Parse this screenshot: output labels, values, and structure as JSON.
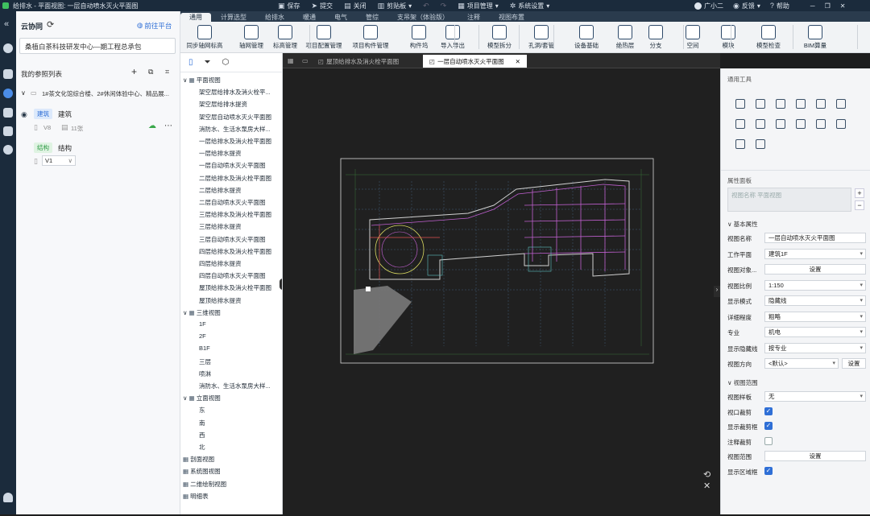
{
  "app": {
    "title": "给排水 - 平面视图: 一层自动喷水灭火平面图"
  },
  "topbar": {
    "save": "保存",
    "submit": "提交",
    "close": "关闭",
    "clipboard": "剪贴板",
    "project_mgmt": "项目管理",
    "settings": "系统设置",
    "user": "广小二",
    "feedback": "反馈",
    "help": "帮助"
  },
  "ribbon_tabs": [
    "通用",
    "计算选型",
    "给排水",
    "暖通",
    "电气",
    "管综",
    "支吊架（体验版）",
    "注释",
    "视图布置"
  ],
  "ribbon_active": "通用",
  "ribbon_buttons": [
    "同步轴网标高",
    "轴网管理",
    "标高管理",
    "项目配置管理",
    "项目构件管理",
    "构件坞",
    "导入导出",
    "模型拆分",
    "孔洞/套管",
    "设备基础",
    "绝热层",
    "分支",
    "空间",
    "模块",
    "模型检查",
    "BIM算量"
  ],
  "cloud": {
    "title": "云协同",
    "goto_platform": "前往平台",
    "project": "桑植白茶科技研发中心—期工程总承包",
    "my_refs": "我的参照列表",
    "ref_item": "1#茶文化馆综合楼、2#休闲体验中心、精品展...",
    "arch_tag": "建筑",
    "arch_name": "建筑",
    "arch_ver": "V8",
    "arch_count": "11张",
    "struct_tag": "结构",
    "struct_name": "结构",
    "struct_ver": "V1"
  },
  "tree": {
    "plan_root": "平面视图",
    "plan_items": [
      "架空层给排水及消火栓平...",
      "架空层给排水提资",
      "架空层自动喷水灭火平面图",
      "消防水、生活水泵房大样...",
      "一层给排水及消火栓平面图",
      "一层给排水提资",
      "一层自动喷水灭火平面图",
      "二层给排水及消火栓平面图",
      "二层给排水提资",
      "二层自动喷水灭火平面图",
      "三层给排水及消火栓平面图",
      "三层给排水提资",
      "三层自动喷水灭火平面图",
      "四层给排水及消火栓平面图",
      "四层给排水提资",
      "四层自动喷水灭火平面图",
      "屋顶给排水及消火栓平面图",
      "屋顶给排水提资"
    ],
    "view3d_root": "三维视图",
    "view3d_items": [
      "1F",
      "2F",
      "B1F",
      "三层",
      "喷淋",
      "消防水、生活水泵房大样..."
    ],
    "elev_root": "立面视图",
    "elev_items": [
      "东",
      "南",
      "西",
      "北"
    ],
    "section": "剖面视图",
    "system": "系统图视图",
    "draft": "二维绘制视图",
    "schedule": "明细表"
  },
  "doc_tabs": {
    "inactive": "屋顶给排水及消火栓平面图",
    "active": "一层自动喷水灭火平面图"
  },
  "props": {
    "tools_title": "通用工具",
    "panel_title": "属性面板",
    "view_name_placeholder": "视图名称 平面视图",
    "basic_section": "基本属性",
    "rows": [
      {
        "label": "视图名称",
        "value": "一层自动喷水灭火平面图"
      },
      {
        "label": "工作平面",
        "value": "建筑1F"
      },
      {
        "label": "视图对象...",
        "value": "设置"
      },
      {
        "label": "视图比例",
        "value": "1:150"
      },
      {
        "label": "显示模式",
        "value": "隐藏线"
      },
      {
        "label": "详细程度",
        "value": "粗略"
      },
      {
        "label": "专业",
        "value": "机电"
      },
      {
        "label": "显示隐藏线",
        "value": "按专业"
      },
      {
        "label": "视图方向",
        "value": "<默认>",
        "button": "设置"
      }
    ],
    "range_section": "视图范围",
    "range_rows": [
      {
        "label": "视图样板",
        "value": "无"
      },
      {
        "label": "视口裁剪",
        "checked": true
      },
      {
        "label": "显示裁剪框",
        "checked": true
      },
      {
        "label": "注释裁剪",
        "checked": false
      },
      {
        "label": "视图范围",
        "value": "设置"
      },
      {
        "label": "显示区域框",
        "checked": true
      }
    ]
  }
}
